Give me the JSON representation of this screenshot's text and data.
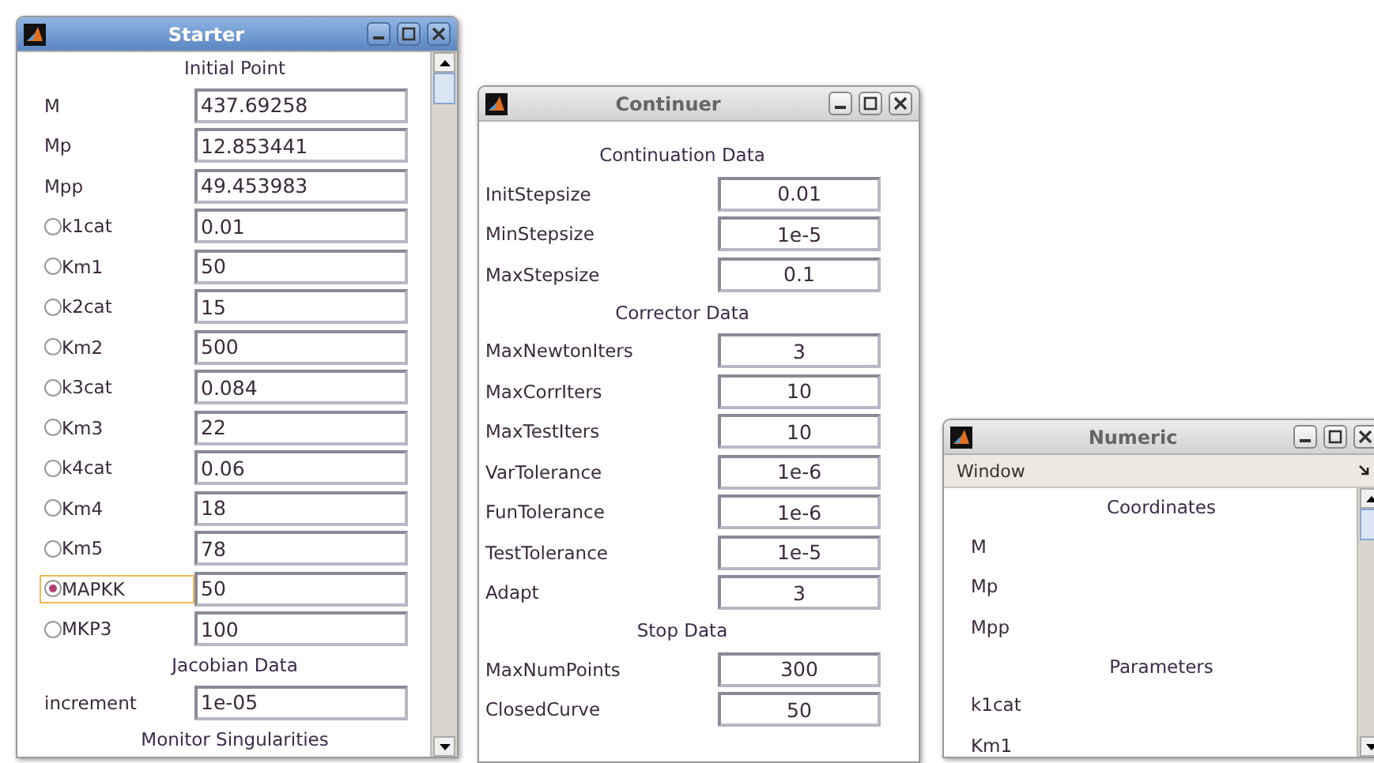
{
  "windows": [
    {
      "kind": "starter",
      "title": "Starter",
      "active": true,
      "scrollbar": true,
      "sections": [
        {
          "heading": "Initial Point",
          "rows": [
            {
              "kind": "plain",
              "label": "M",
              "value": "437.69258"
            },
            {
              "kind": "plain",
              "label": "Mp",
              "value": "12.853441"
            },
            {
              "kind": "plain",
              "label": "Mpp",
              "value": "49.453983"
            },
            {
              "kind": "radio",
              "label": "k1cat",
              "value": "0.01",
              "selected": false
            },
            {
              "kind": "radio",
              "label": "Km1",
              "value": "50",
              "selected": false
            },
            {
              "kind": "radio",
              "label": "k2cat",
              "value": "15",
              "selected": false
            },
            {
              "kind": "radio",
              "label": "Km2",
              "value": "500",
              "selected": false
            },
            {
              "kind": "radio",
              "label": "k3cat",
              "value": "0.084",
              "selected": false
            },
            {
              "kind": "radio",
              "label": "Km3",
              "value": "22",
              "selected": false
            },
            {
              "kind": "radio",
              "label": "k4cat",
              "value": "0.06",
              "selected": false
            },
            {
              "kind": "radio",
              "label": "Km4",
              "value": "18",
              "selected": false
            },
            {
              "kind": "radio",
              "label": "Km5",
              "value": "78",
              "selected": false
            },
            {
              "kind": "radio",
              "label": "MAPKK",
              "value": "50",
              "selected": true
            },
            {
              "kind": "radio",
              "label": "MKP3",
              "value": "100",
              "selected": false
            }
          ]
        },
        {
          "heading": "Jacobian Data",
          "rows": [
            {
              "kind": "plain",
              "label": "increment",
              "value": "1e-05"
            }
          ]
        },
        {
          "heading": "Monitor Singularities"
        }
      ]
    },
    {
      "kind": "continuer",
      "title": "Continuer",
      "active": false,
      "scrollbar": false,
      "sections": [
        {
          "heading": "Continuation Data",
          "rows": [
            {
              "kind": "plain",
              "label": "InitStepsize",
              "value": "0.01"
            },
            {
              "kind": "plain",
              "label": "MinStepsize",
              "value": "1e-5"
            },
            {
              "kind": "plain",
              "label": "MaxStepsize",
              "value": "0.1"
            }
          ]
        },
        {
          "heading": "Corrector Data",
          "rows": [
            {
              "kind": "plain",
              "label": "MaxNewtonIters",
              "value": "3"
            },
            {
              "kind": "plain",
              "label": "MaxCorrIters",
              "value": "10"
            },
            {
              "kind": "plain",
              "label": "MaxTestIters",
              "value": "10"
            },
            {
              "kind": "plain",
              "label": "VarTolerance",
              "value": "1e-6"
            },
            {
              "kind": "plain",
              "label": "FunTolerance",
              "value": "1e-6"
            },
            {
              "kind": "plain",
              "label": "TestTolerance",
              "value": "1e-5"
            },
            {
              "kind": "plain",
              "label": "Adapt",
              "value": "3"
            }
          ]
        },
        {
          "heading": "Stop Data",
          "rows": [
            {
              "kind": "plain",
              "label": "MaxNumPoints",
              "value": "300"
            },
            {
              "kind": "plain",
              "label": "ClosedCurve",
              "value": "50"
            }
          ]
        }
      ]
    },
    {
      "kind": "numeric",
      "title": "Numeric",
      "active": false,
      "scrollbar": true,
      "menu": "Window",
      "sections": [
        {
          "heading": "Coordinates",
          "rows": [
            {
              "kind": "plain",
              "label": "M"
            },
            {
              "kind": "plain",
              "label": "Mp"
            },
            {
              "kind": "plain",
              "label": "Mpp"
            }
          ]
        },
        {
          "heading": "Parameters",
          "rows": [
            {
              "kind": "plain",
              "label": "k1cat"
            },
            {
              "kind": "plain",
              "label": "Km1"
            }
          ]
        }
      ]
    }
  ]
}
